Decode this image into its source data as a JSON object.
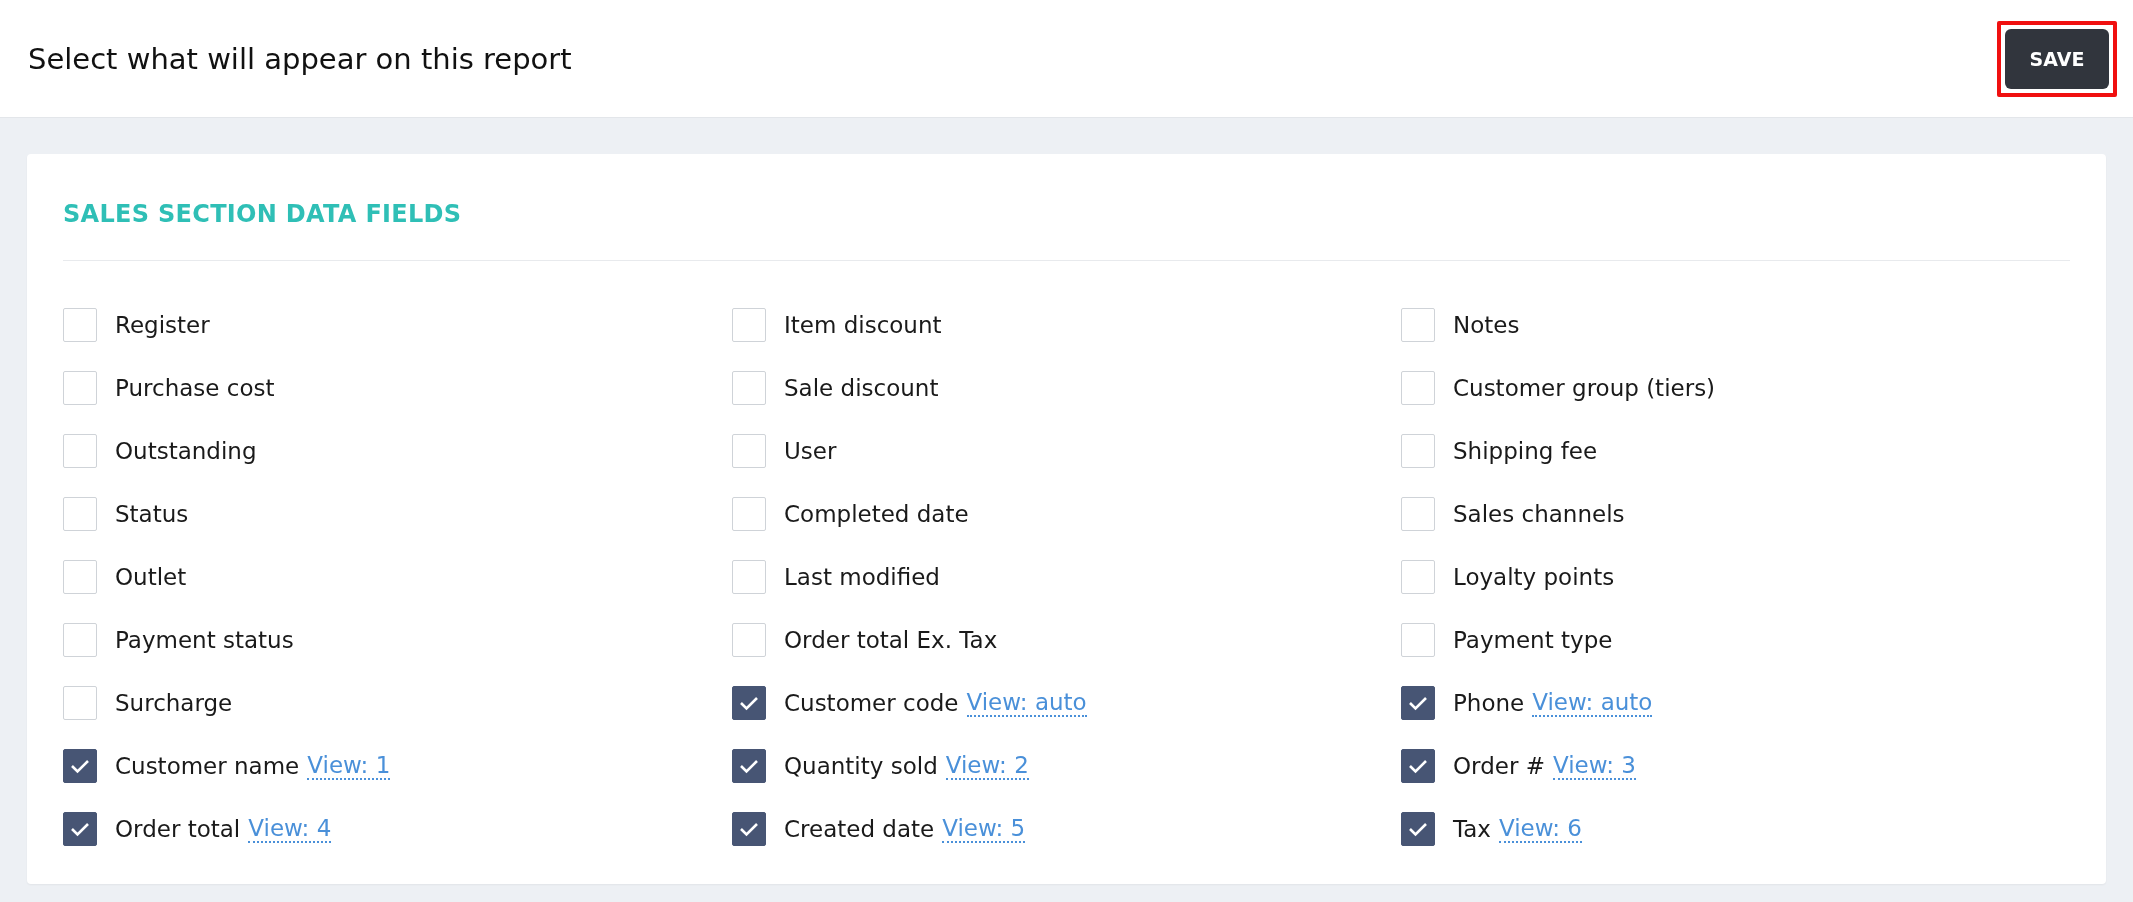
{
  "header": {
    "title": "Select what will appear on this report",
    "save_button": {
      "label": "SAVE",
      "highlighted": true
    }
  },
  "section": {
    "title": "SALES SECTION DATA FIELDS",
    "fields": [
      {
        "label": "Register",
        "checked": false
      },
      {
        "label": "Item discount",
        "checked": false
      },
      {
        "label": "Notes",
        "checked": false
      },
      {
        "label": "Purchase cost",
        "checked": false
      },
      {
        "label": "Sale discount",
        "checked": false
      },
      {
        "label": "Customer group (tiers)",
        "checked": false
      },
      {
        "label": "Outstanding",
        "checked": false
      },
      {
        "label": "User",
        "checked": false
      },
      {
        "label": "Shipping fee",
        "checked": false
      },
      {
        "label": "Status",
        "checked": false
      },
      {
        "label": "Completed date",
        "checked": false
      },
      {
        "label": "Sales channels",
        "checked": false
      },
      {
        "label": "Outlet",
        "checked": false
      },
      {
        "label": "Last modified",
        "checked": false
      },
      {
        "label": "Loyalty points",
        "checked": false
      },
      {
        "label": "Payment status",
        "checked": false
      },
      {
        "label": "Order total Ex. Tax",
        "checked": false
      },
      {
        "label": "Payment type",
        "checked": false
      },
      {
        "label": "Surcharge",
        "checked": false
      },
      {
        "label": "Customer code",
        "checked": true,
        "view": "View: auto"
      },
      {
        "label": "Phone",
        "checked": true,
        "view": "View: auto"
      },
      {
        "label": "Customer name",
        "checked": true,
        "view": "View: 1"
      },
      {
        "label": "Quantity sold",
        "checked": true,
        "view": "View: 2"
      },
      {
        "label": "Order #",
        "checked": true,
        "view": "View: 3"
      },
      {
        "label": "Order total",
        "checked": true,
        "view": "View: 4"
      },
      {
        "label": "Created date",
        "checked": true,
        "view": "View: 5"
      },
      {
        "label": "Tax",
        "checked": true,
        "view": "View: 6"
      }
    ]
  }
}
